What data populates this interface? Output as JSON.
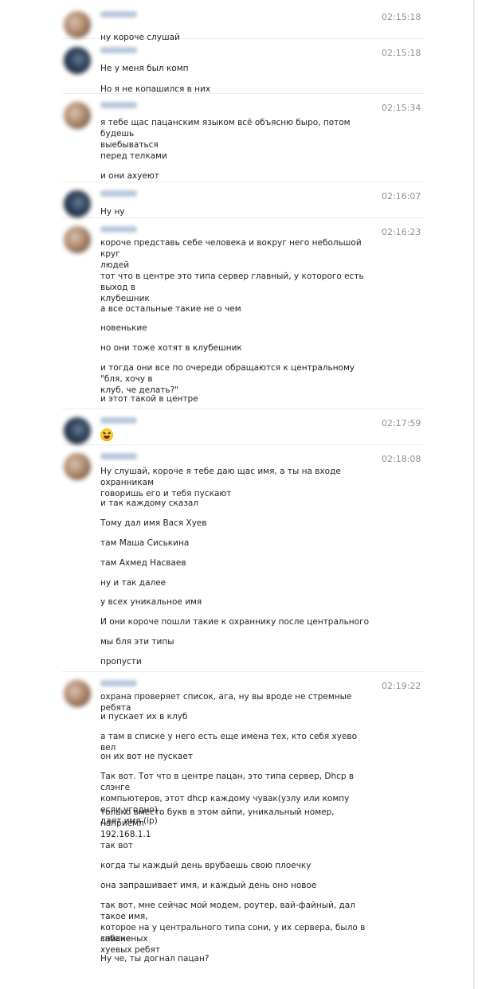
{
  "messages": [
    {
      "avatar": "user-a-avatar",
      "time": "02:15:18",
      "lines": [
        "ну короче слушай"
      ]
    },
    {
      "avatar": "user-b-avatar",
      "time": "02:15:18",
      "lines": [
        "Не у меня был комп",
        "Но я не копашился в них"
      ]
    },
    {
      "avatar": "user-a-avatar",
      "time": "02:15:34",
      "lines": [
        "я тебе щас пацанским языком всё объясню быро, потом будешь\nвыебываться",
        "перед телками",
        "и они ахуеют"
      ]
    },
    {
      "avatar": "user-b-avatar",
      "time": "02:16:07",
      "lines": [
        "Ну ну"
      ]
    },
    {
      "avatar": "user-a-avatar",
      "time": "02:16:23",
      "lines": [
        "короче представь себе человека и вокруг него небольшой круг\nлюдей",
        "тот что в центре это типа сервер главный, у которого есть выход в\nклубешник",
        "а все остальные такие не о чем",
        "новенькие",
        "но они тоже хотят в клубешник",
        "и тогда они все по очереди обращаются к центральному \"бля, хочу в\nклуб, че делать?\"",
        "и этот такой в центре"
      ]
    },
    {
      "avatar": "user-b-avatar",
      "time": "02:17:59",
      "emoji": "laughing-tears-emoji",
      "lines": []
    },
    {
      "avatar": "user-a-avatar",
      "time": "02:18:08",
      "lines": [
        "Ну слушай, короче я тебе даю щас имя, а ты на входе охранникам\nговоришь его и тебя пускают",
        "и так каждому сказал",
        "Тому дал имя Вася Хуев",
        "там Маша Сиськина",
        "там Ахмед Насваев",
        "ну и так далее",
        "у всех уникальное имя",
        "И они короче пошли такие к охраннику после центрального",
        "мы бля эти типы",
        "пропусти"
      ]
    },
    {
      "avatar": "user-a-avatar",
      "time": "02:19:22",
      "lines": [
        "охрана проверяет список, ага, ну вы вроде не стремные ребята",
        "и пускает их в клуб",
        "а там в списке у него есть еще имена тех, кто себя хуево вел",
        "он их вот не пускает",
        "Так вот. Тот что в центре пацан, это типа сервер, Dhcp в слэнге\nкомпьютеров, этот dhcp каждому чувак(узлу или компу если угодно)\nдает имя (ip)",
        "только вместо букв в этом айпи, уникальный номер, наприемл\n192.168.1.1",
        "так вот",
        "когда ты каждый день врубаешь свою плоечку",
        "она запрашивает имя, и каждый день оно новое",
        "так вот, мне сейчас мой модем, роутер, вай-файный, дал такое имя,\nкоторое на у центрального типа сони, у их сервера, было в списке\nхуевых ребят",
        "забаненых",
        "Ну че, ты догнал пацан?"
      ]
    }
  ]
}
